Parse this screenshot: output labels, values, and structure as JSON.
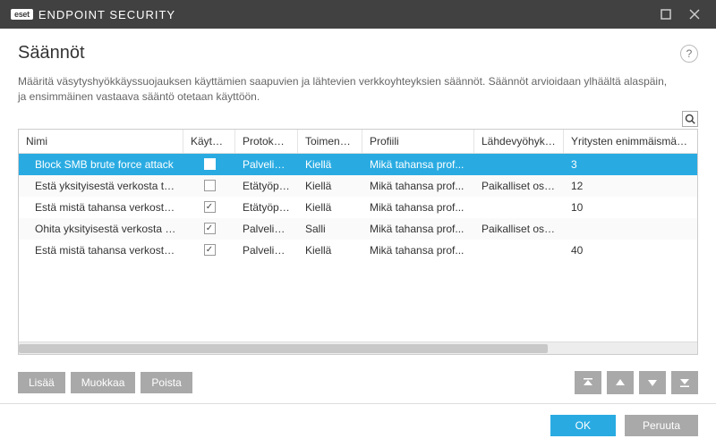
{
  "brand": {
    "badge": "eset",
    "product": "ENDPOINT SECURITY"
  },
  "page_title": "Säännöt",
  "description": "Määritä väsytyshyökkäyssuojauksen käyttämien saapuvien ja lähtevien verkkoyhteyksien säännöt. Säännöt arvioidaan ylhäältä alaspäin, ja ensimmäinen vastaava sääntö otetaan käyttöön.",
  "columns": {
    "name": "Nimi",
    "enabled": "Käytössä",
    "protocol": "Protokolla",
    "action": "Toimenpide",
    "profile": "Profiili",
    "source_zones": "Lähdevyöhykkeet",
    "max_attempts": "Yritysten enimmäismäärä"
  },
  "rows": [
    {
      "name": "Block SMB brute force attack",
      "enabled": false,
      "protocol": "Palvelim...",
      "action": "Kiellä",
      "profile": "Mikä tahansa prof...",
      "source_zones": "",
      "max_attempts": "3",
      "selected": true
    },
    {
      "name": "Estä yksityisestä verkosta tul...",
      "enabled": false,
      "protocol": "Etätyöpöyt...",
      "action": "Kiellä",
      "profile": "Mikä tahansa prof...",
      "source_zones": "Paikalliset osoit...",
      "max_attempts": "12",
      "selected": false
    },
    {
      "name": "Estä mistä tahansa verkosta ...",
      "enabled": true,
      "protocol": "Etätyöpöyt...",
      "action": "Kiellä",
      "profile": "Mikä tahansa prof...",
      "source_zones": "",
      "max_attempts": "10",
      "selected": false
    },
    {
      "name": "Ohita yksityisestä verkosta t...",
      "enabled": true,
      "protocol": "Palvelim...",
      "action": "Salli",
      "profile": "Mikä tahansa prof...",
      "source_zones": "Paikalliset osoit...",
      "max_attempts": "",
      "selected": false
    },
    {
      "name": "Estä mistä tahansa verkosta ...",
      "enabled": true,
      "protocol": "Palvelim...",
      "action": "Kiellä",
      "profile": "Mikä tahansa prof...",
      "source_zones": "",
      "max_attempts": "40",
      "selected": false
    }
  ],
  "toolbar": {
    "add": "Lisää",
    "edit": "Muokkaa",
    "delete": "Poista"
  },
  "footer": {
    "ok": "OK",
    "cancel": "Peruuta"
  },
  "colors": {
    "accent": "#29abe2",
    "titlebar": "#414141",
    "button": "#a9a9a9"
  }
}
